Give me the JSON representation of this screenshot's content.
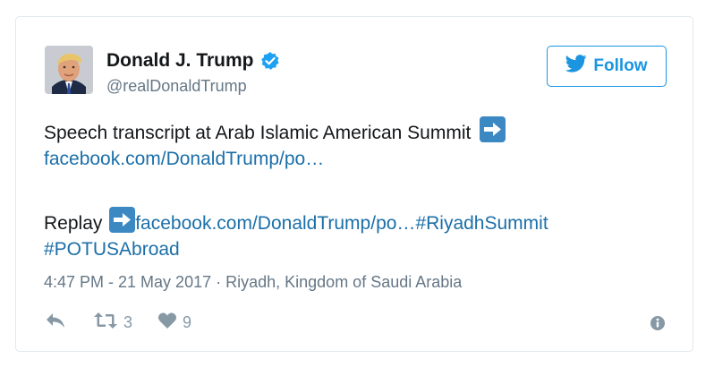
{
  "author": {
    "name": "Donald J. Trump",
    "handle": "@realDonaldTrump"
  },
  "follow_button": {
    "label": "Follow"
  },
  "tweet": {
    "line1_text": "Speech transcript at Arab Islamic American Summit",
    "line1_link": "facebook.com/DonaldTrump/po…",
    "line2_prefix": "Replay",
    "line2_link": "facebook.com/DonaldTrump/po…",
    "hashtag1": "#RiyadhSummit",
    "hashtag2": "#POTUSAbroad"
  },
  "meta": {
    "timestamp": "4:47 PM - 21 May 2017",
    "separator": " · ",
    "location": "Riyadh, Kingdom of Saudi Arabia"
  },
  "actions": {
    "retweet_count": "3",
    "like_count": "9"
  },
  "icons": {
    "verified": "verified-badge-icon",
    "arrow": "right-arrow-emoji-icon",
    "reply": "reply-icon",
    "retweet": "retweet-icon",
    "like": "heart-icon",
    "info": "info-icon",
    "bird": "twitter-bird-icon"
  },
  "colors": {
    "accent": "#1b95e0",
    "link": "#1b6fa8",
    "text": "#14171a",
    "muted": "#657786",
    "icon": "#8899a6",
    "arrow_bg": "#3b88c3"
  }
}
